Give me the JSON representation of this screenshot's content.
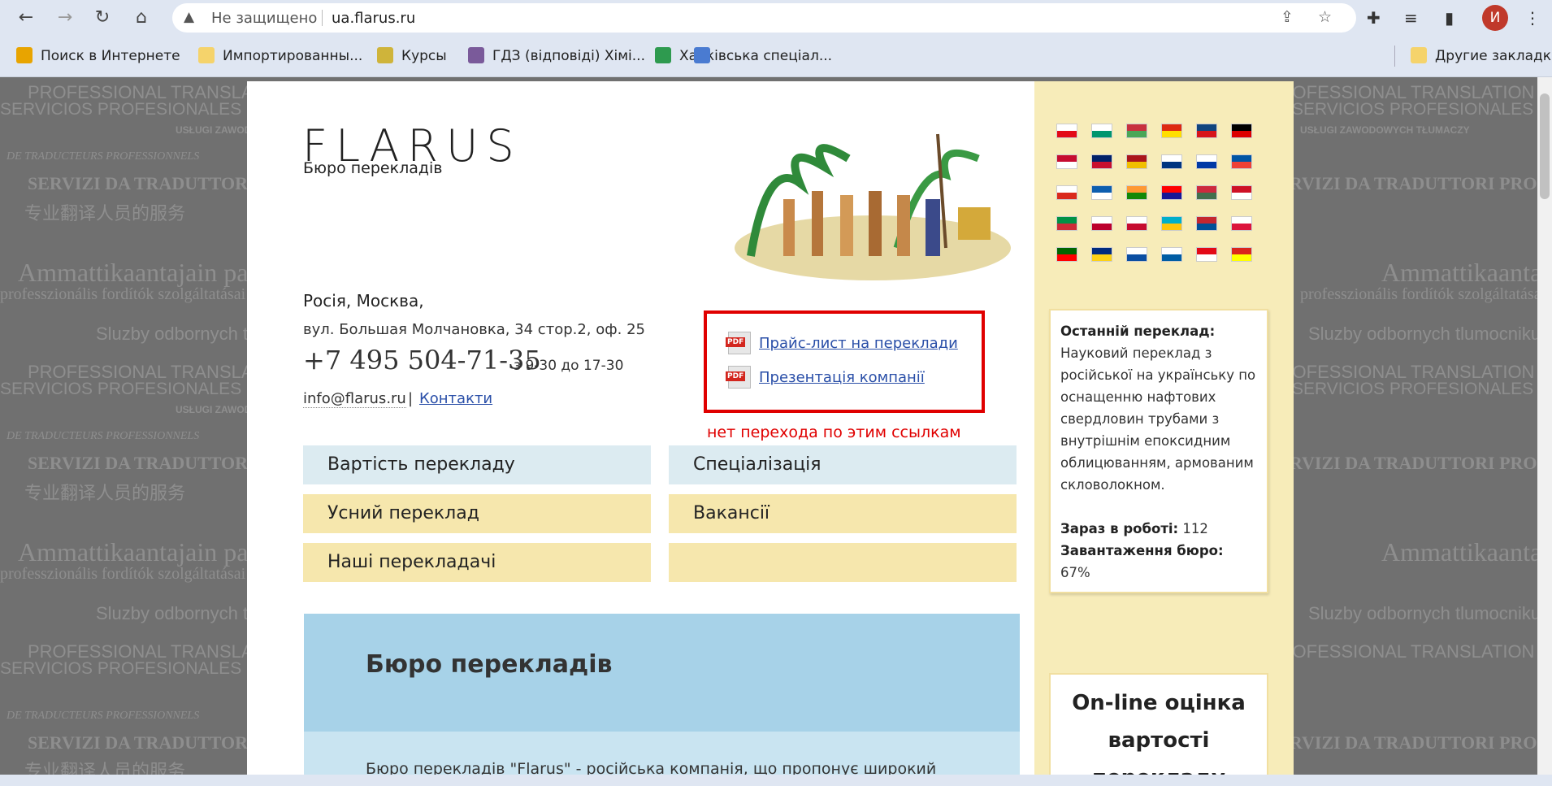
{
  "browser": {
    "security_label": "Не защищено",
    "url": "ua.flarus.ru",
    "profile_initial": "И",
    "bookmarks": [
      {
        "label": "Поиск в Интернете",
        "color": "#e8a400"
      },
      {
        "label": "Импортированны...",
        "color": "#f5d36b"
      },
      {
        "label": "Курсы",
        "color": "#cfb43a"
      },
      {
        "label": "ГДЗ (відповіді) Хімі...",
        "color": "#7a5a9a"
      },
      {
        "label": "Харківська спеціал...",
        "color": "#2e9a4f"
      }
    ],
    "other_bookmarks": "Другие закладки"
  },
  "watermark": {
    "line1": "PROFESSIONAL TRANSLATION SERVICES",
    "line2": "SERVICIOS PROFESIONALES DE LOS TRADUCTORES",
    "line3": "USŁUGI ZAWODOWYCH TŁUMACZY",
    "line4": "DE TRADUCTEURS PROFESSIONNELS",
    "line5": "SERVIZI DA TRADUTTORI PROFESSIONISTI",
    "line6": "专业翻译人员的服务",
    "line7": "Ammattikaantajain palvelut",
    "line8": "professzionális fordítók szolgáltatásai",
    "line9": "Sluzby odbornych tlumocniku"
  },
  "site": {
    "logo": "FLARUS",
    "tagline": "Бюро перекладів",
    "address_city": "Росія, Москва,",
    "address_street": "вул. Большая Молчановка, 34 стор.2, оф. 25",
    "phone": "+7 495 504-71-35",
    "hours": "з 9-30 до 17-30",
    "email": "info@flarus.ru",
    "contacts": "Контакти",
    "pdf_links": [
      "Прайс-лист на переклади",
      "Презентація компанії"
    ],
    "annotation_note": "нет перехода по этим ссылкам",
    "nav": [
      {
        "label": "Вартість перекладу",
        "style": "blue"
      },
      {
        "label": "Спеціалізація",
        "style": "blue"
      },
      {
        "label": "Усний переклад",
        "style": "yellow"
      },
      {
        "label": "Вакансії",
        "style": "yellow"
      },
      {
        "label": "Наші перекладачі",
        "style": "yellow"
      },
      {
        "label": "",
        "style": "yellow"
      }
    ],
    "banner_title": "Бюро перекладів",
    "banner_text": "Бюро перекладів \"Flarus\" - російська компанія, що пропонує широкий"
  },
  "sidebar": {
    "flags": [
      [
        "#fff",
        "#e30a17"
      ],
      [
        "#fff",
        "#00966e"
      ],
      [
        "#c8313e",
        "#4aa657"
      ],
      [
        "#de2910",
        "#ffde00"
      ],
      [
        "#11457e",
        "#d7141a"
      ],
      [
        "#000",
        "#dd0000"
      ],
      [
        "#c60c30",
        "#fff"
      ],
      [
        "#012169",
        "#c8102e"
      ],
      [
        "#aa151b",
        "#f1bf00"
      ],
      [
        "#fff",
        "#003580"
      ],
      [
        "#fff",
        "#0039a6"
      ],
      [
        "#0055a4",
        "#ef4135"
      ],
      [
        "#fff",
        "#da291c"
      ],
      [
        "#0d5eaf",
        "#fff"
      ],
      [
        "#ff9933",
        "#138808"
      ],
      [
        "#ff0000",
        "#171796"
      ],
      [
        "#cd2a3e",
        "#436f4d"
      ],
      [
        "#ce1126",
        "#fff"
      ],
      [
        "#009246",
        "#ce2b37"
      ],
      [
        "#fff",
        "#bc002d"
      ],
      [
        "#fff",
        "#c60c30"
      ],
      [
        "#00afca",
        "#fec50c"
      ],
      [
        "#c4272f",
        "#015197"
      ],
      [
        "#fff",
        "#dc143c"
      ],
      [
        "#006600",
        "#ff0000"
      ],
      [
        "#002b7f",
        "#fcd116"
      ],
      [
        "#fff",
        "#0b4ea2"
      ],
      [
        "#fff",
        "#005da4"
      ],
      [
        "#e30a17",
        "#fff"
      ],
      [
        "#da251d",
        "#ffff00"
      ]
    ],
    "last_translation_title": "Останній переклад:",
    "last_translation_text": "Науковий переклад з російської на українську по оснащенню нафтових свердловин трубами з внутрішнім епоксидним облицюванням, армованим скловолокном.",
    "in_work_label": "Зараз в роботі:",
    "in_work_value": "112",
    "load_label": "Завантаження бюро:",
    "load_value": "67%",
    "online_title": "On-line оцінка вартості перекладу"
  }
}
